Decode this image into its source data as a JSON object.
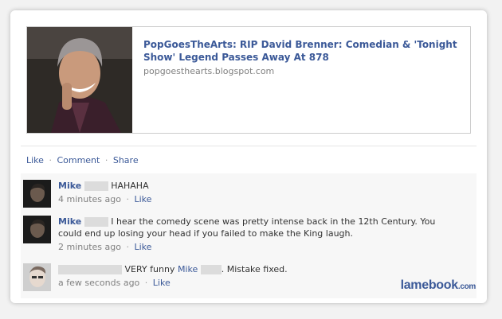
{
  "share": {
    "title": "PopGoesTheArts: RIP David Brenner: Comedian & 'Tonight Show' Legend Passes Away At 878",
    "url": "popgoesthearts.blogspot.com"
  },
  "actions": {
    "like": "Like",
    "comment": "Comment",
    "share": "Share",
    "separator": "·"
  },
  "comments": [
    {
      "author": "Mike",
      "text": "HAHAHA",
      "time": "4 minutes ago",
      "like": "Like"
    },
    {
      "author": "Mike",
      "text": "I hear the comedy scene was pretty intense back in the 12th Century. You could end up losing your head if you failed to make the King laugh.",
      "time": "2 minutes ago",
      "like": "Like"
    },
    {
      "author": "",
      "text_before": "VERY funny",
      "mention": "Mike",
      "text_after": ". Mistake fixed.",
      "time": "a few seconds ago",
      "like": "Like"
    }
  ],
  "watermark": {
    "name": "lamebook",
    "suffix": ".com"
  },
  "colors": {
    "link": "#3b5998",
    "meta": "#808080",
    "redaction": "#dcdcdc"
  }
}
